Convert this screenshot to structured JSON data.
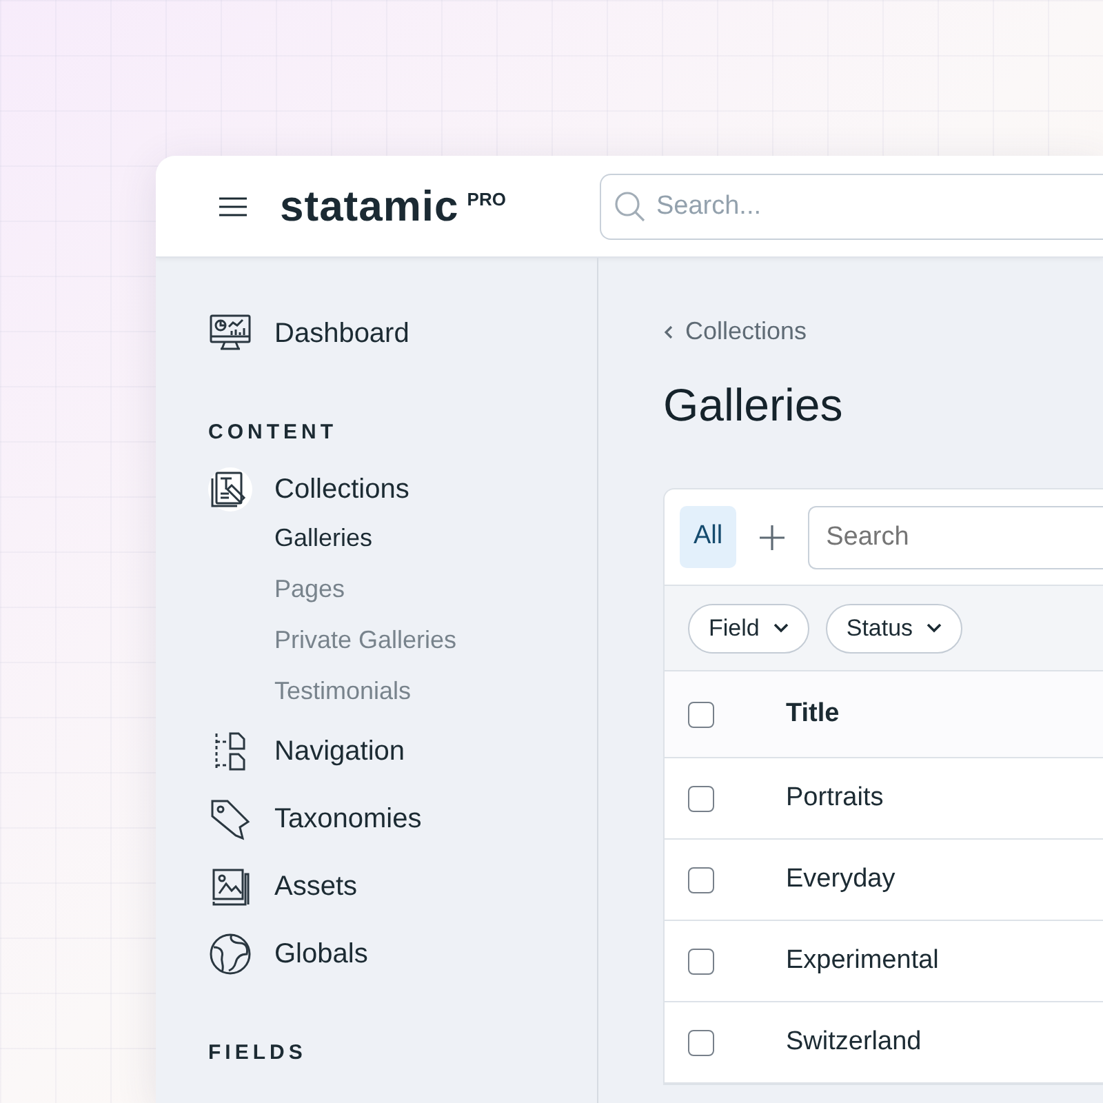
{
  "header": {
    "logo": "statamic",
    "badge": "PRO",
    "search": {
      "placeholder": "Search..."
    }
  },
  "sidebar": {
    "top": [
      {
        "label": "Dashboard",
        "selected": false
      }
    ],
    "sections": [
      {
        "heading": "CONTENT",
        "items": [
          {
            "label": "Collections",
            "selected": true,
            "children": [
              {
                "label": "Galleries",
                "selected": true
              },
              {
                "label": "Pages",
                "selected": false
              },
              {
                "label": "Private Galleries",
                "selected": false
              },
              {
                "label": "Testimonials",
                "selected": false
              }
            ]
          },
          {
            "label": "Navigation",
            "selected": false
          },
          {
            "label": "Taxonomies",
            "selected": false
          },
          {
            "label": "Assets",
            "selected": false
          },
          {
            "label": "Globals",
            "selected": false
          }
        ]
      },
      {
        "heading": "FIELDS"
      }
    ]
  },
  "main": {
    "breadcrumb": "Collections",
    "title": "Galleries",
    "listing": {
      "tabs": [
        {
          "label": "All",
          "selected": true
        }
      ],
      "search": {
        "placeholder": "Search"
      },
      "filters": [
        "Field",
        "Status"
      ],
      "table": {
        "columns": [
          "Title"
        ],
        "select_all_checked": false,
        "rows": [
          {
            "title": "Portraits",
            "checked": false
          },
          {
            "title": "Everyday",
            "checked": false
          },
          {
            "title": "Experimental",
            "checked": false
          },
          {
            "title": "Switzerland",
            "checked": false
          }
        ]
      }
    }
  }
}
